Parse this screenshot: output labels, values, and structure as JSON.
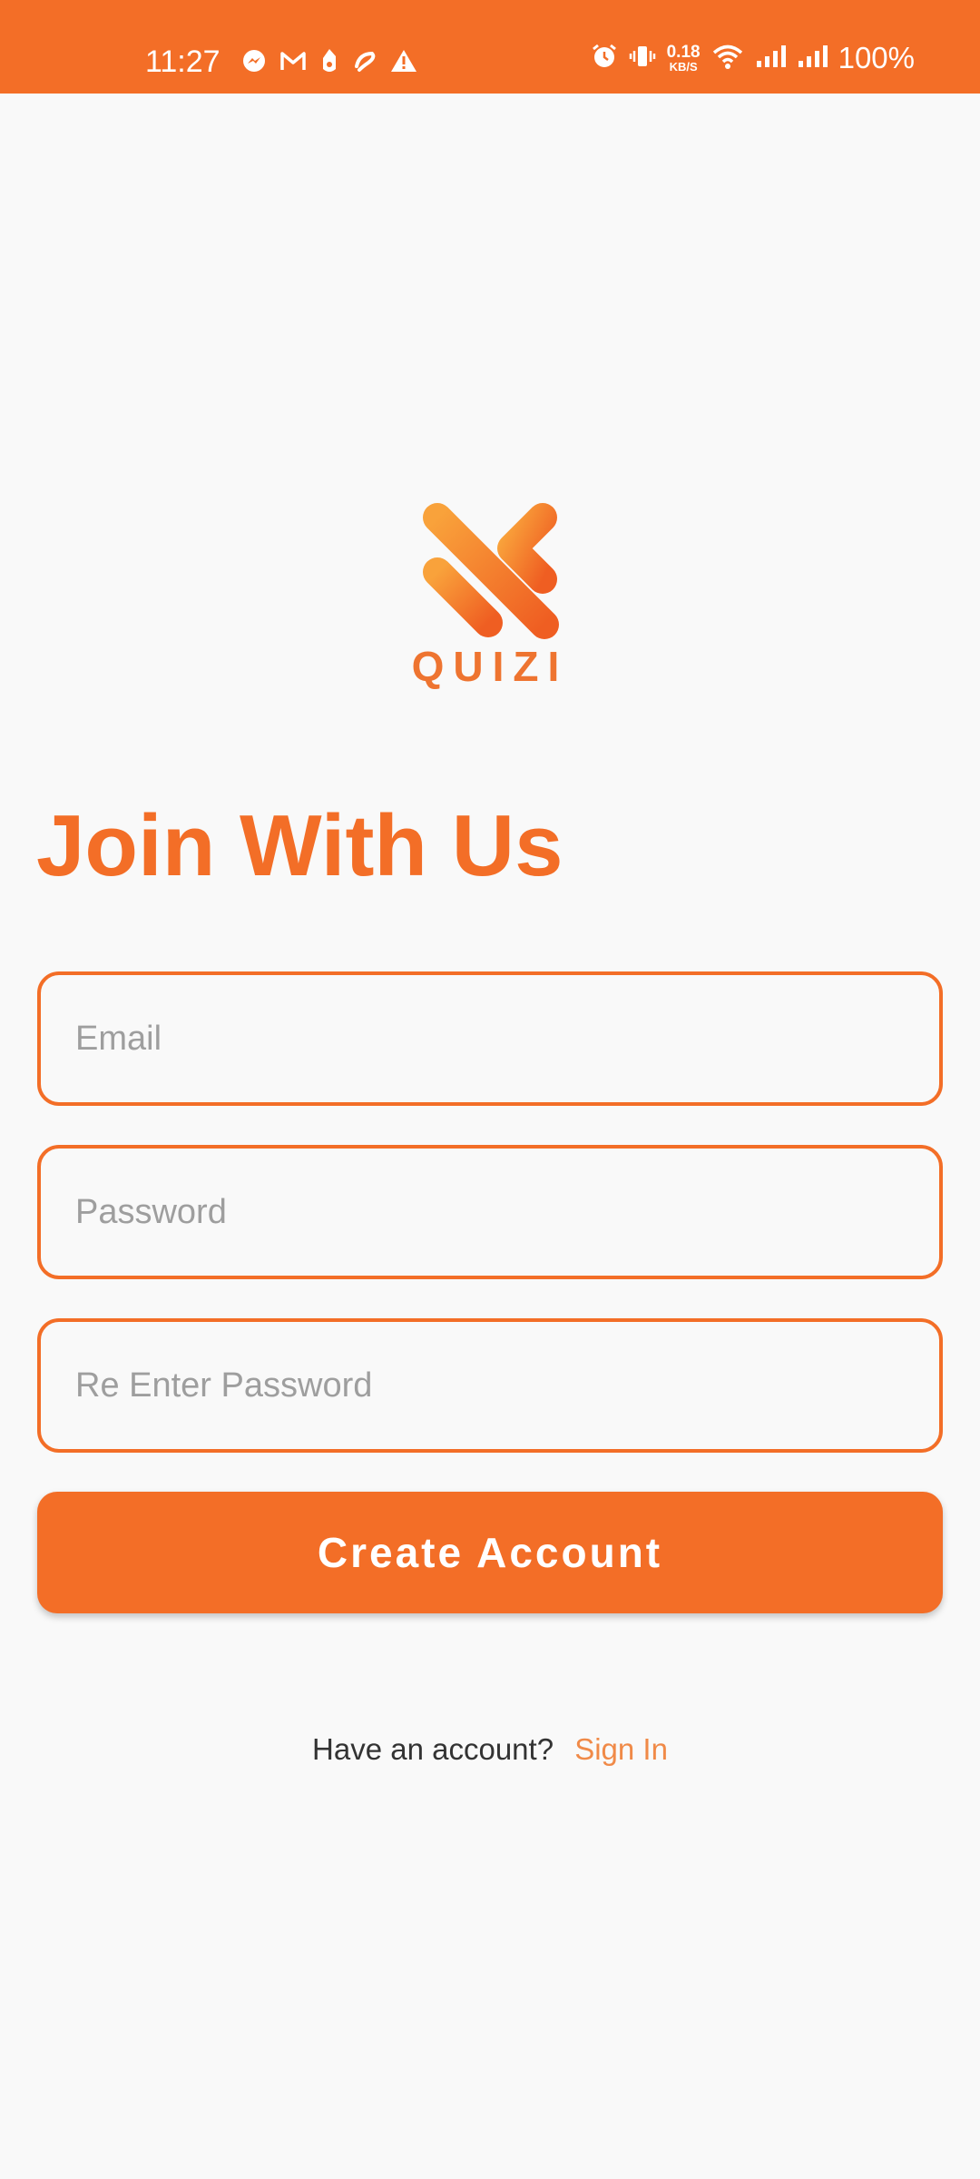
{
  "status_bar": {
    "time": "11:27",
    "net_speed_value": "0.18",
    "net_speed_unit": "KB/S",
    "battery": "100%",
    "icons_left": [
      "messenger-icon",
      "gmail-icon",
      "app-notification-icon",
      "airtel-icon",
      "warning-icon"
    ],
    "icons_right": [
      "alarm-icon",
      "vibrate-icon",
      "wifi-icon",
      "signal-icon",
      "signal-icon"
    ]
  },
  "logo": {
    "wordmark": "QUIZI",
    "icon": "quizi-logo-icon"
  },
  "page": {
    "title": "Join With Us"
  },
  "form": {
    "email_placeholder": "Email",
    "email_value": "",
    "password_placeholder": "Password",
    "password_value": "",
    "repassword_placeholder": "Re Enter Password",
    "repassword_value": "",
    "submit_label": "Create Account"
  },
  "footer": {
    "prompt": "Have an account?",
    "link": "Sign In"
  },
  "colors": {
    "accent": "#f36e27",
    "background": "#f9f9f9",
    "placeholder": "#9e9e9e",
    "link": "#f08a48"
  }
}
